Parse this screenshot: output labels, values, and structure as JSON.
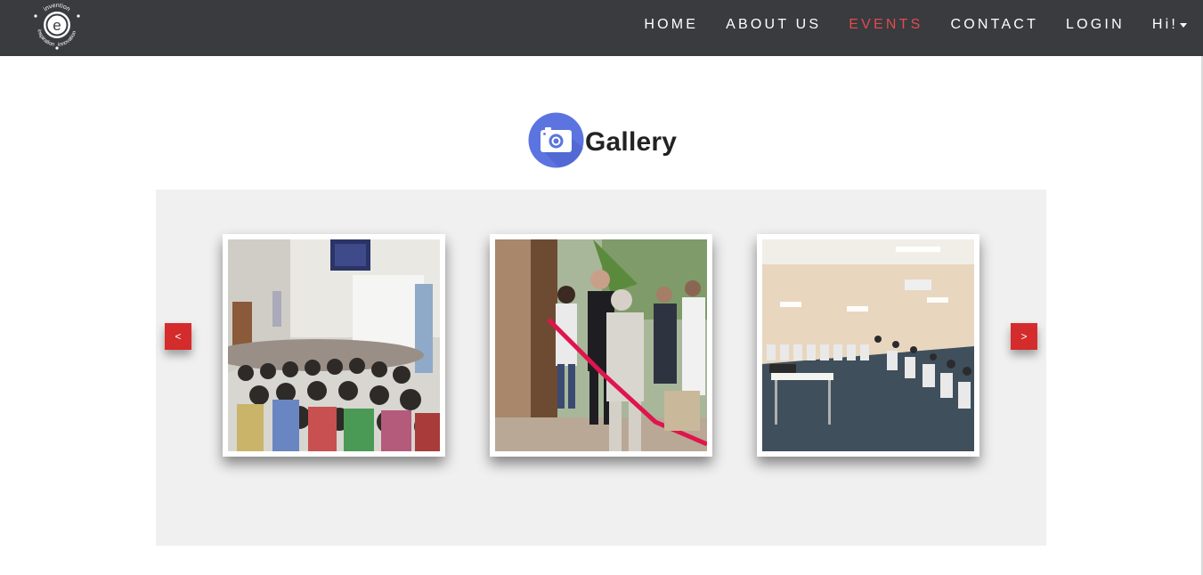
{
  "brand": {
    "logo_text_top": "invention",
    "logo_text_bottom": "innovation",
    "logo_text_left": "inspiration",
    "logo_letter": "e"
  },
  "nav": {
    "items": [
      {
        "label": "HOME"
      },
      {
        "label": "ABOUT US"
      },
      {
        "label": "EVENTS",
        "active": true
      },
      {
        "label": "CONTACT"
      },
      {
        "label": "LOGIN"
      },
      {
        "label": "Hi!",
        "dropdown": true
      }
    ]
  },
  "gallery": {
    "title": "Gallery",
    "icon": "camera-icon",
    "prev_label": "<",
    "next_label": ">",
    "photos": [
      {
        "subject": "seminar-audience"
      },
      {
        "subject": "ribbon-cutting"
      },
      {
        "subject": "computer-lab"
      }
    ]
  },
  "colors": {
    "navbar": "#393b3f",
    "accent": "#e24b4b",
    "arrow": "#d42c2c",
    "carousel_bg": "#f0f0f0",
    "camera_circle": "#5b74e0"
  }
}
